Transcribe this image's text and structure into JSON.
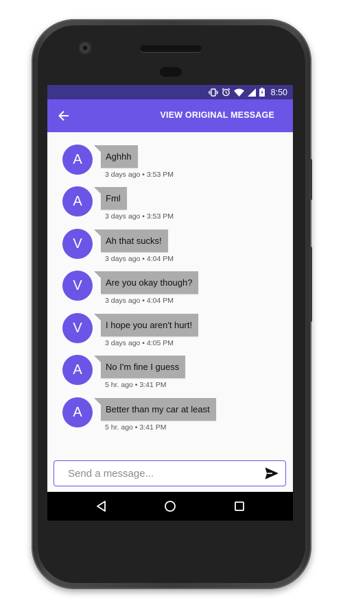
{
  "status_bar": {
    "time": "8:50",
    "icons": [
      "vibrate-icon",
      "alarm-icon",
      "wifi-icon",
      "signal-icon",
      "battery-icon"
    ]
  },
  "toolbar": {
    "back_icon": "arrow-back-icon",
    "action_label": "VIEW ORIGINAL MESSAGE"
  },
  "messages": [
    {
      "initial": "A",
      "text": "Aghhh",
      "time": "3 days ago • 3:53 PM"
    },
    {
      "initial": "A",
      "text": "Fml",
      "time": "3 days ago • 3:53 PM"
    },
    {
      "initial": "V",
      "text": "Ah that sucks!",
      "time": "3 days ago • 4:04 PM"
    },
    {
      "initial": "V",
      "text": "Are you okay though?",
      "time": "3 days ago • 4:04 PM"
    },
    {
      "initial": "V",
      "text": "I hope you aren't hurt!",
      "time": "3 days ago • 4:05 PM"
    },
    {
      "initial": "A",
      "text": "No I'm fine I guess",
      "time": "5 hr. ago • 3:41 PM"
    },
    {
      "initial": "A",
      "text": "Better than my car at least",
      "time": "5 hr. ago • 3:41 PM"
    }
  ],
  "composer": {
    "placeholder": "Send a message...",
    "value": "",
    "send_icon": "send-icon"
  },
  "nav_bar": {
    "icons": [
      "back-triangle-icon",
      "home-circle-icon",
      "recents-square-icon"
    ]
  },
  "colors": {
    "accent": "#6a55e6",
    "status_bar": "#3d348b",
    "bubble": "#acacac"
  }
}
